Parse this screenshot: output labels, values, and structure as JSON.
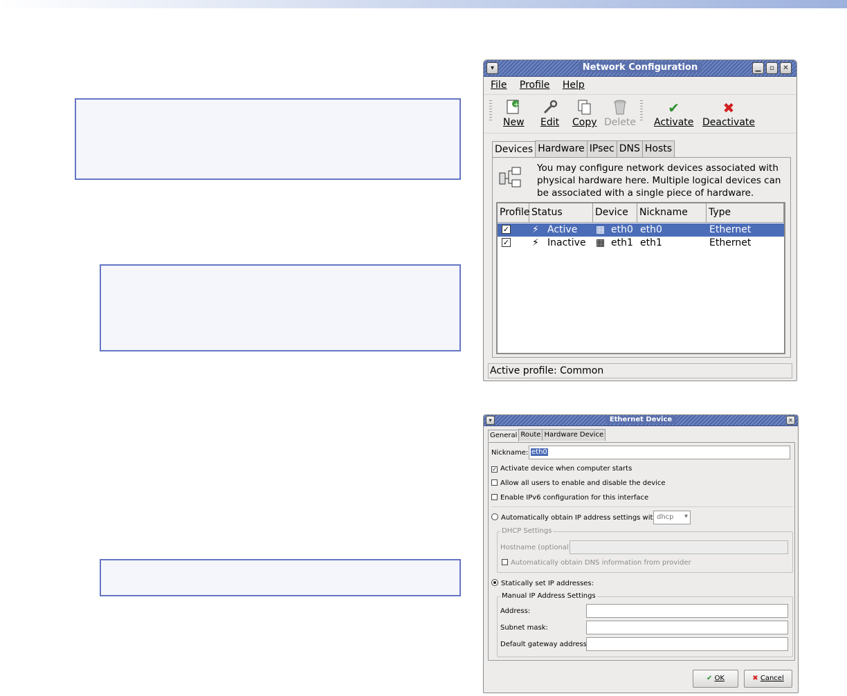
{
  "network_window": {
    "title": "Network Configuration",
    "menu": [
      "File",
      "Profile",
      "Help"
    ],
    "toolbar": {
      "new": "New",
      "edit": "Edit",
      "copy": "Copy",
      "delete": "Delete",
      "activate": "Activate",
      "deactivate": "Deactivate"
    },
    "tabs": [
      "Devices",
      "Hardware",
      "IPsec",
      "DNS",
      "Hosts"
    ],
    "info_text": "You may configure network devices associated with physical hardware here.  Multiple logical devices can be associated with a single piece of hardware.",
    "columns": [
      "Profile",
      "Status",
      "Device",
      "Nickname",
      "Type"
    ],
    "rows": [
      {
        "profile": "✓",
        "status": "Active",
        "device": "eth0",
        "nickname": "eth0",
        "type": "Ethernet"
      },
      {
        "profile": "✓",
        "status": "Inactive",
        "device": "eth1",
        "nickname": "eth1",
        "type": "Ethernet"
      }
    ],
    "status_bar": "Active profile: Common"
  },
  "ethernet_window": {
    "title": "Ethernet Device",
    "tabs": [
      "General",
      "Route",
      "Hardware Device"
    ],
    "nickname_label": "Nickname:",
    "nickname_value": "eth0",
    "activate_on_start": "Activate device when computer starts",
    "allow_users": "Allow all users to enable and disable the device",
    "enable_ipv6": "Enable IPv6 configuration for this interface",
    "auto_obtain": "Automatically obtain IP address settings with:",
    "dhcp_option": "dhcp",
    "dhcp_group": "DHCP Settings",
    "hostname_label": "Hostname (optional):",
    "auto_dns": "Automatically obtain DNS information from provider",
    "static": "Statically set IP addresses:",
    "manual_group": "Manual IP Address Settings",
    "address_label": "Address:",
    "subnet_label": "Subnet mask:",
    "gateway_label": "Default gateway address:",
    "ok": "OK",
    "cancel": "Cancel"
  }
}
